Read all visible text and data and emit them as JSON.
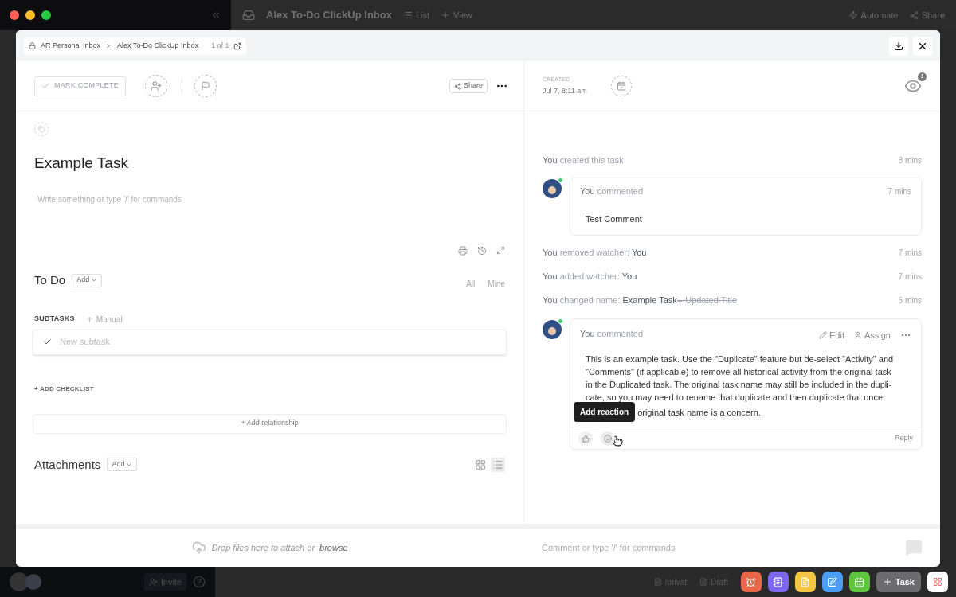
{
  "app_bar": {
    "title": "Alex To-Do ClickUp Inbox",
    "view_tabs": [
      "List",
      "View"
    ],
    "actions": [
      "Automate",
      "Share"
    ]
  },
  "breadcrumb": {
    "items": [
      "AR Personal Inbox",
      "Alex To-Do ClickUp Inbox"
    ],
    "counter": "1 of 1"
  },
  "toolbar": {
    "mark_complete": "MARK COMPLETE",
    "share": "Share",
    "created_label": "CREATED",
    "created_date": "Jul 7, 8:11 am",
    "watcher_count": "1"
  },
  "task": {
    "title": "Example Task",
    "description_placeholder": "Write something or type '/' for commands",
    "status": "To Do",
    "status_add": "Add",
    "filters": [
      {
        "label": "All",
        "selected": false
      },
      {
        "label": "Mine",
        "selected": false
      }
    ],
    "subtasks_label": "SUBTASKS",
    "sort": "Manual",
    "new_subtask_placeholder": "New subtask",
    "add_checklist": "+ ADD CHECKLIST",
    "add_relationship": "+ Add relationship",
    "attachments_title": "Attachments",
    "attachments_add": "Add",
    "attachment_views": [
      {
        "kind": "grid",
        "selected": false
      },
      {
        "kind": "list",
        "selected": true
      }
    ]
  },
  "activity": [
    {
      "kind": "event",
      "actor": "You",
      "action": "created this task",
      "time": "8 mins"
    },
    {
      "kind": "comment",
      "actor": "You",
      "verb": "commented",
      "time": "7 mins",
      "body": "Test Comment"
    },
    {
      "kind": "event",
      "actor": "You",
      "action": "removed watcher:",
      "value": "You",
      "time": "7 mins"
    },
    {
      "kind": "event",
      "actor": "You",
      "action": "added watcher:",
      "value": "You",
      "time": "7 mins"
    },
    {
      "kind": "event",
      "actor": "You",
      "action": "changed name:",
      "value": "Example Task",
      "old_value": "-- Updated Title",
      "time": "6 mins"
    },
    {
      "kind": "comment",
      "actor": "You",
      "verb": "commented",
      "actions": [
        "Edit",
        "Assign"
      ],
      "body_lines": [
        "This is an example task. Use the \"Duplicate\" feature but de-select \"Activity\" and",
        "\"Comments\" (if applicable) to remove all historical activity from the original task",
        "in the Duplicated task. The original task name may still be included in the dupli-",
        "cate, so you may need to rename that duplicate and then duplicate that once"
      ],
      "body_tail": "original task name is a concern.",
      "tooltip": "Add reaction",
      "reply": "Reply"
    }
  ],
  "drop_zone": {
    "text": "Drop files here to attach or",
    "link": "browse"
  },
  "comment_input": {
    "placeholder": "Comment or type '/' for commands"
  },
  "bottom_bar": {
    "invite": "Invite",
    "drafts": [
      "/privat",
      "Draft"
    ],
    "apps": [
      {
        "kind": "alarm",
        "color": "#e8664a"
      },
      {
        "kind": "notes",
        "color": "#7b68ee"
      },
      {
        "kind": "doc",
        "color": "#f4c543"
      },
      {
        "kind": "edit",
        "color": "#4a9ff5"
      },
      {
        "kind": "calendar",
        "color": "#5fc43f"
      }
    ],
    "task_button": "Task"
  }
}
